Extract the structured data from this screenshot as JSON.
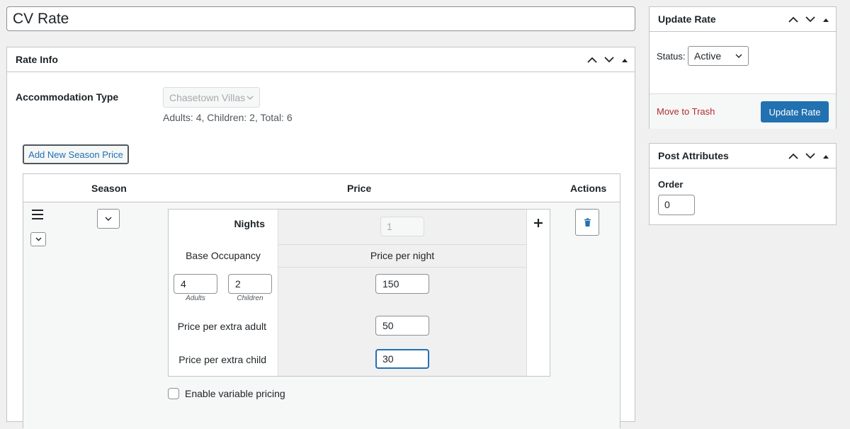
{
  "post_title": "CV Rate",
  "rate_info": {
    "title": "Rate Info",
    "accommodation_type_label": "Accommodation Type",
    "accommodation_type_value": "Chasetown Villas",
    "occupancy_text": "Adults: 4, Children: 2, Total: 6",
    "add_season_label": "Add New Season Price",
    "table": {
      "headers": {
        "season": "Season",
        "price": "Price",
        "actions": "Actions"
      },
      "nights_label": "Nights",
      "nights_value": "1",
      "base_occupancy_label": "Base Occupancy",
      "price_per_night_label": "Price per night",
      "adults_value": "4",
      "adults_caption": "Adults",
      "children_value": "2",
      "children_caption": "Children",
      "base_price": "150",
      "extra_adult_label": "Price per extra adult",
      "extra_adult_price": "50",
      "extra_child_label": "Price per extra child",
      "extra_child_price": "30",
      "variable_pricing_label": "Enable variable pricing",
      "variable_pricing_checked": false
    }
  },
  "update_rate": {
    "title": "Update Rate",
    "status_label": "Status:",
    "status_value": "Active",
    "trash_label": "Move to Trash",
    "update_label": "Update Rate"
  },
  "post_attributes": {
    "title": "Post Attributes",
    "order_label": "Order",
    "order_value": "0"
  },
  "colors": {
    "primary": "#2271b1",
    "danger": "#b32d2e"
  },
  "icons": [
    "chevron-up-icon",
    "chevron-down-icon",
    "triangle-up-icon",
    "drag-handle-icon",
    "trash-icon",
    "plus-icon"
  ]
}
